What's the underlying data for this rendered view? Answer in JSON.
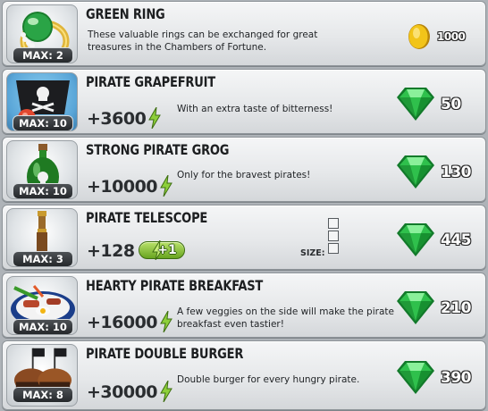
{
  "colors": {
    "panel_bg": "#e6e8ea",
    "gem_green": "#1fae3a",
    "coin_gold": "#f2c419",
    "energy_green": "#6fb52a",
    "badge_dark": "#2e3235"
  },
  "items": [
    {
      "name": "GREEN RING",
      "max": "MAX: 2",
      "description": "These valuable rings can be exchanged for great treasures in the Chambers of Fortune.",
      "energy": "",
      "price": "1000",
      "currency_icon": "gold-coin-icon",
      "thumb_icon": "green-ring-icon"
    },
    {
      "name": "PIRATE GRAPEFRUIT",
      "max": "MAX: 10",
      "description": "With an extra taste of bitterness!",
      "energy": "+3600",
      "price": "50",
      "currency_icon": "green-gem-icon",
      "thumb_icon": "pirate-grapefruit-icon"
    },
    {
      "name": "STRONG PIRATE GROG",
      "max": "MAX: 10",
      "description": "Only for the bravest pirates!",
      "energy": "+10000",
      "price": "130",
      "currency_icon": "green-gem-icon",
      "thumb_icon": "grog-bottle-icon"
    },
    {
      "name": "PIRATE TELESCOPE",
      "max": "MAX: 3",
      "description": "",
      "energy": "+128",
      "bonus": "+1",
      "size_label": "SIZE:",
      "size_slots": 3,
      "price": "445",
      "currency_icon": "green-gem-icon",
      "thumb_icon": "telescope-icon"
    },
    {
      "name": "HEARTY PIRATE BREAKFAST",
      "max": "MAX: 10",
      "description": "A few veggies on the side will make the pirate breakfast even tastier!",
      "energy": "+16000",
      "price": "210",
      "currency_icon": "green-gem-icon",
      "thumb_icon": "breakfast-plate-icon"
    },
    {
      "name": "PIRATE DOUBLE BURGER",
      "max": "MAX: 8",
      "description": "Double burger for every hungry pirate.",
      "energy": "+30000",
      "price": "390",
      "currency_icon": "green-gem-icon",
      "thumb_icon": "double-burger-icon"
    }
  ]
}
